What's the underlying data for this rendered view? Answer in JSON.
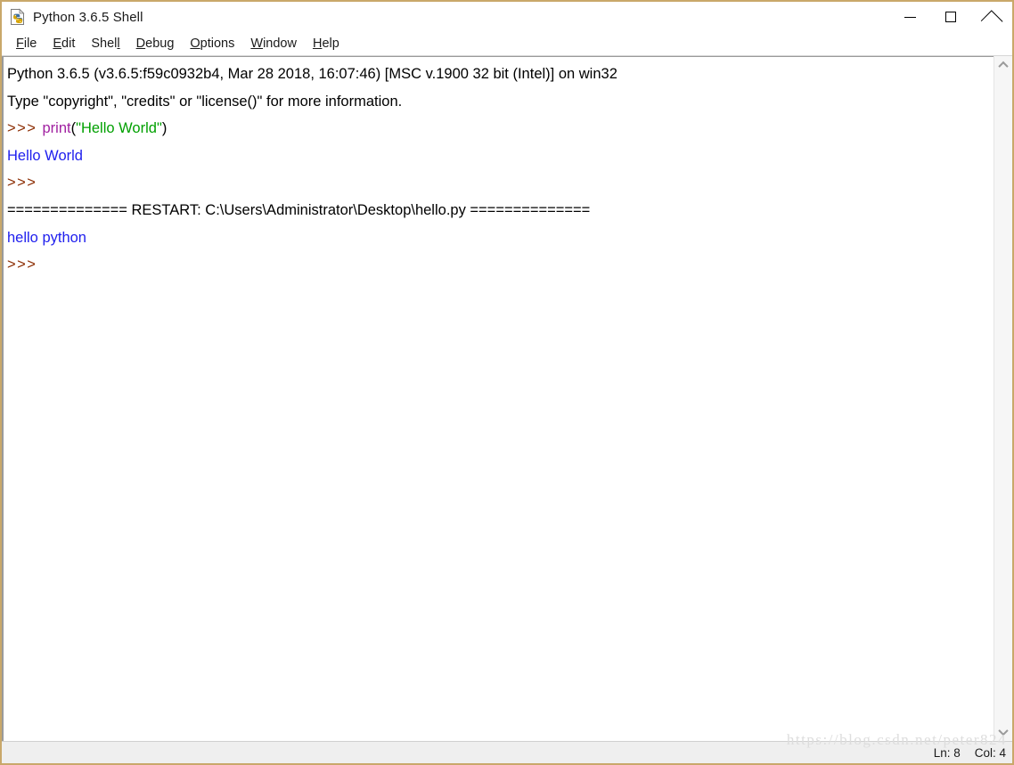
{
  "window": {
    "title": "Python 3.6.5 Shell",
    "icon": "python-file-icon",
    "border_color": "#c9a86a",
    "controls": {
      "minimize": "minimize-icon",
      "maximize": "maximize-icon",
      "close": "close-icon"
    }
  },
  "menubar": {
    "items": [
      {
        "label": "File",
        "accel_index": 0
      },
      {
        "label": "Edit",
        "accel_index": 0
      },
      {
        "label": "Shell",
        "accel_index": 4
      },
      {
        "label": "Debug",
        "accel_index": 0
      },
      {
        "label": "Options",
        "accel_index": 0
      },
      {
        "label": "Window",
        "accel_index": 0
      },
      {
        "label": "Help",
        "accel_index": 0
      }
    ]
  },
  "shell": {
    "colors": {
      "prompt": "#8b2b00",
      "builtin": "#a020a0",
      "string": "#00a000",
      "output": "#2020ee",
      "plain": "#000000",
      "background": "#ffffff"
    },
    "lines": [
      {
        "name": "banner-version-line",
        "spans": [
          {
            "class": "tok-plain",
            "text": "Python 3.6.5 (v3.6.5:f59c0932b4, Mar 28 2018, 16:07:46) [MSC v.1900 32 bit (Intel)] on win32"
          }
        ]
      },
      {
        "name": "banner-help-line",
        "spans": [
          {
            "class": "tok-plain",
            "text": "Type \"copyright\", \"credits\" or \"license()\" for more information."
          }
        ]
      },
      {
        "name": "input-line-print",
        "spans": [
          {
            "class": "tok-prompt",
            "text": ">>> "
          },
          {
            "class": "tok-builtin",
            "text": "print"
          },
          {
            "class": "tok-plain",
            "text": "("
          },
          {
            "class": "tok-string",
            "text": "\"Hello World\""
          },
          {
            "class": "tok-plain",
            "text": ")"
          }
        ]
      },
      {
        "name": "output-line-hello-world",
        "spans": [
          {
            "class": "tok-output",
            "text": "Hello World"
          }
        ]
      },
      {
        "name": "prompt-line-empty-1",
        "spans": [
          {
            "class": "tok-prompt",
            "text": ">>> "
          }
        ]
      },
      {
        "name": "restart-separator-line",
        "spans": [
          {
            "class": "tok-plain",
            "text": "============== RESTART: C:\\Users\\Administrator\\Desktop\\hello.py =============="
          }
        ]
      },
      {
        "name": "output-line-hello-python",
        "spans": [
          {
            "class": "tok-output",
            "text": "hello python"
          }
        ]
      },
      {
        "name": "prompt-line-empty-2",
        "spans": [
          {
            "class": "tok-prompt",
            "text": ">>> "
          }
        ]
      }
    ]
  },
  "scrollbar": {
    "up_arrow": "chevron-up-icon",
    "down_arrow": "chevron-down-icon"
  },
  "statusbar": {
    "line": "Ln: 8",
    "col": "Col: 4"
  },
  "watermark": {
    "text": "https://blog.csdn.net/peter824"
  }
}
